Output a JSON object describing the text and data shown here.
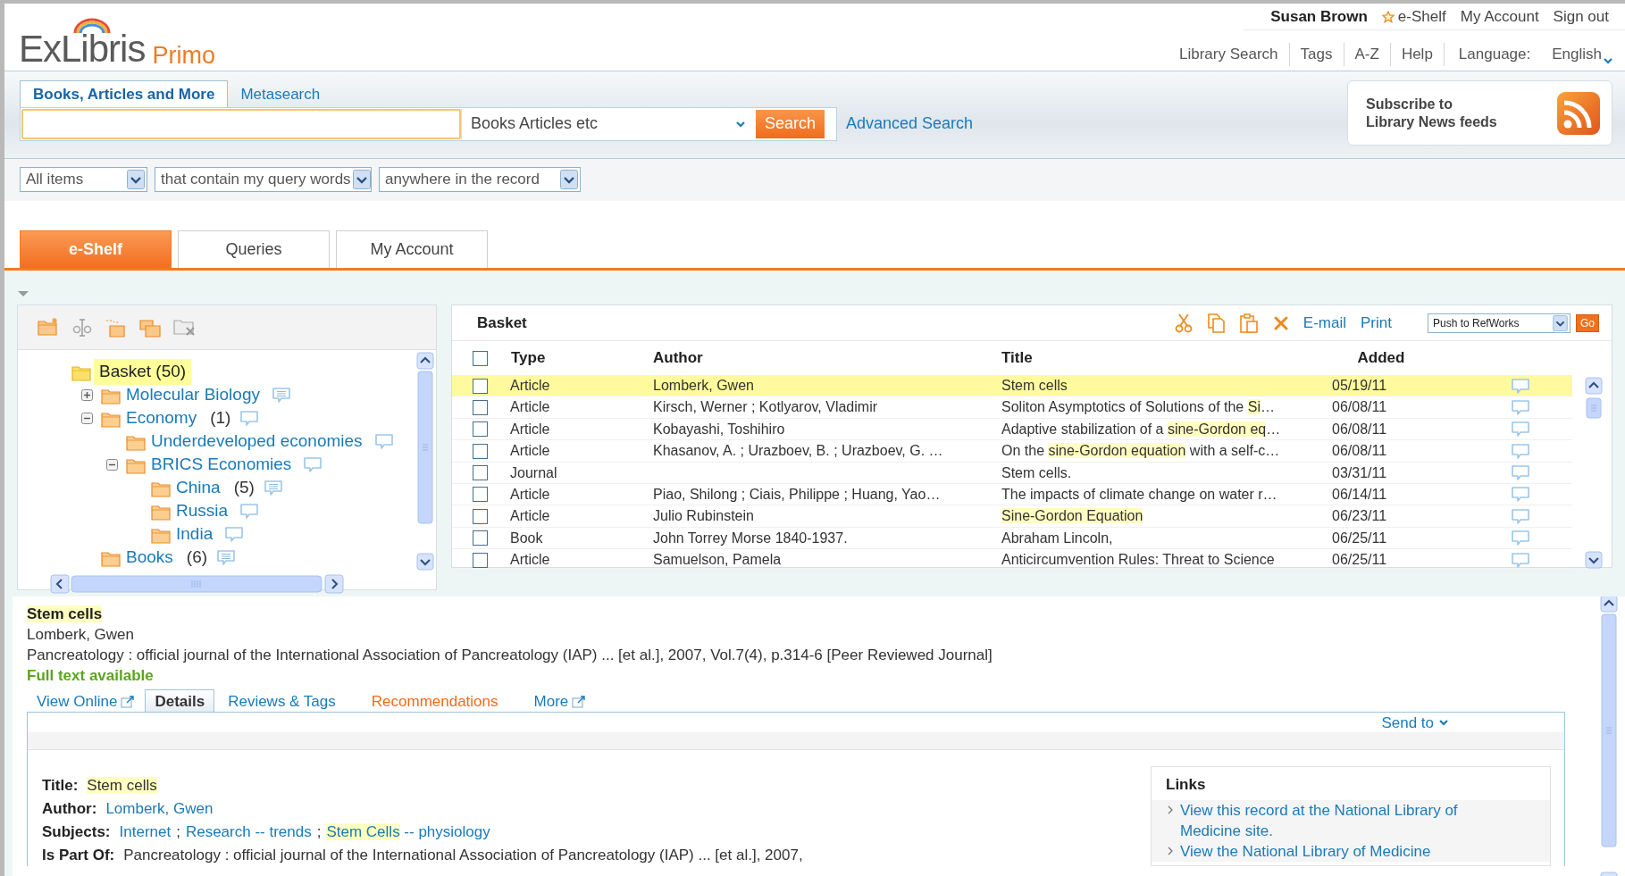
{
  "user_bar": {
    "user_name": "Susan Brown",
    "links": [
      {
        "label": "e-Shelf",
        "kind": "starred"
      },
      {
        "label": "My Account",
        "kind": "plain"
      },
      {
        "label": "Sign out",
        "kind": "plain"
      }
    ]
  },
  "logo": {
    "wordmark": "ExLibris",
    "product": "Primo"
  },
  "nav": {
    "links": [
      "Library Search",
      "Tags",
      "A-Z",
      "Help"
    ],
    "language_label": "Language:",
    "language": "English"
  },
  "search": {
    "tabs": [
      {
        "label": "Books, Articles and More",
        "selected": true
      },
      {
        "label": "Metasearch",
        "selected": false
      }
    ],
    "scope": "Books Articles etc",
    "button": "Search",
    "advanced": "Advanced Search"
  },
  "rss": {
    "text": "Subscribe to\nLibrary News feeds"
  },
  "filters": [
    "All items",
    "that contain my query words",
    "anywhere in the record"
  ],
  "main_tabs": [
    {
      "label": "e-Shelf",
      "selected": true
    },
    {
      "label": "Queries",
      "selected": false
    },
    {
      "label": "My Account",
      "selected": false
    }
  ],
  "folder_tree": [
    {
      "label": "Basket (50)",
      "selected": true,
      "children": [
        {
          "label": "Molecular Biology",
          "selected": false,
          "expanded": false,
          "has_notes": true
        },
        {
          "label": "Economy",
          "count": "(1)",
          "selected": false,
          "expanded": true,
          "has_notes": false,
          "children": [
            {
              "label": "Underdeveloped economies",
              "selected": false,
              "has_notes": false
            },
            {
              "label": "BRICS Economies",
              "selected": false,
              "expanded": true,
              "has_notes": false,
              "children": [
                {
                  "label": "China",
                  "count": "(5)",
                  "selected": false,
                  "has_notes": true
                },
                {
                  "label": "Russia",
                  "selected": false,
                  "has_notes": false
                },
                {
                  "label": "India",
                  "selected": false,
                  "has_notes": false
                }
              ]
            }
          ]
        },
        {
          "label": "Books",
          "count": "(6)",
          "selected": false,
          "has_notes": true
        }
      ]
    }
  ],
  "basket": {
    "title": "Basket",
    "actions": [
      "E-mail",
      "Print"
    ],
    "push_select": "Push to RefWorks",
    "go_button": "Go",
    "select_all_checked": false,
    "columns": [
      "Type",
      "Author",
      "Title",
      "Added"
    ],
    "rows": [
      {
        "type": "Article",
        "author": "Lomberk, Gwen",
        "title": [
          {
            "text": "Stem cells",
            "highlighted": false
          }
        ],
        "added": "05/19/11",
        "selected": true,
        "checked": false
      },
      {
        "type": "Article",
        "author": "Kirsch, Werner ; Kotlyarov, Vladimir",
        "title": [
          {
            "text": "Soliton Asymptotics of Solutions of the ",
            "highlighted": false
          },
          {
            "text": "Si",
            "highlighted": true
          },
          {
            "text": "…",
            "highlighted": false
          }
        ],
        "added": "06/08/11",
        "selected": false,
        "checked": false
      },
      {
        "type": "Article",
        "author": "Kobayashi, Toshihiro",
        "title": [
          {
            "text": "Adaptive stabilization of a ",
            "highlighted": false
          },
          {
            "text": "sine-Gordon ",
            "highlighted": true
          },
          {
            "text": "eq",
            "highlighted": true
          },
          {
            "text": "…",
            "highlighted": false
          }
        ],
        "added": "06/08/11",
        "selected": false,
        "checked": false
      },
      {
        "type": "Article",
        "author": "Khasanov, A. ; Urazboev, B. ; Urazboev, G. …",
        "title": [
          {
            "text": "On the ",
            "highlighted": false
          },
          {
            "text": "sine-Gordon equation",
            "highlighted": true
          },
          {
            "text": " with a self-c…",
            "highlighted": false
          }
        ],
        "added": "06/08/11",
        "selected": false,
        "checked": false
      },
      {
        "type": "Journal",
        "author": "",
        "title": [
          {
            "text": "Stem cells.",
            "highlighted": false
          }
        ],
        "added": "03/31/11",
        "selected": false,
        "checked": false
      },
      {
        "type": "Article",
        "author": "Piao, Shilong ; Ciais, Philippe ; Huang, Yao…",
        "title": [
          {
            "text": "The impacts of climate change on water r…",
            "highlighted": false
          }
        ],
        "added": "06/14/11",
        "selected": false,
        "checked": false
      },
      {
        "type": "Article",
        "author": "Julio Rubinstein",
        "title": [
          {
            "text": "Sine-Gordon Equation",
            "highlighted": true
          }
        ],
        "added": "06/23/11",
        "selected": false,
        "checked": false
      },
      {
        "type": "Book",
        "author": "John Torrey Morse 1840-1937.",
        "title": [
          {
            "text": "Abraham Lincoln,",
            "highlighted": false
          }
        ],
        "added": "06/25/11",
        "selected": false,
        "checked": false
      },
      {
        "type": "Article",
        "author": "Samuelson, Pamela",
        "title": [
          {
            "text": "Anticircumvention Rules: Threat to Science",
            "highlighted": false
          }
        ],
        "added": "06/25/11",
        "selected": false,
        "checked": false
      }
    ]
  },
  "record": {
    "title": [
      {
        "text": "Stem ",
        "highlighted": true
      },
      {
        "text": "cells",
        "highlighted": true
      }
    ],
    "author": "Lomberk, Gwen",
    "source": "Pancreatology : official journal of the International Association of Pancreatology (IAP) ... [et al.], 2007, Vol.7(4), p.314-6 [Peer Reviewed Journal]",
    "availability": "Full text available",
    "tabs": [
      {
        "label": "View Online",
        "kind": "external",
        "color": "#1a7ab8",
        "selected": false
      },
      {
        "label": "Details",
        "kind": "plain",
        "color": "#333333",
        "selected": true
      },
      {
        "label": "Reviews & Tags",
        "kind": "plain",
        "color": "#1a7ab8",
        "selected": false
      },
      {
        "label": "Recommendations",
        "kind": "plain",
        "color": "#f26a1b",
        "selected": false
      },
      {
        "label": "More",
        "kind": "external",
        "color": "#1a7ab8",
        "selected": false
      }
    ],
    "send_to": "Send to",
    "details": [
      {
        "label": "Title:",
        "kind": "text",
        "parts": [
          {
            "text": "Stem ",
            "highlighted": true
          },
          {
            "text": "cells",
            "highlighted": true
          }
        ]
      },
      {
        "label": "Author:",
        "kind": "links",
        "links": [
          {
            "parts": [
              {
                "text": "Lomberk, Gwen",
                "highlighted": false
              }
            ]
          }
        ]
      },
      {
        "label": "Subjects:",
        "kind": "links",
        "separator": ";",
        "links": [
          {
            "parts": [
              {
                "text": "Internet",
                "highlighted": false
              }
            ]
          },
          {
            "parts": [
              {
                "text": "Research -- trends",
                "highlighted": false
              }
            ]
          },
          {
            "parts": [
              {
                "text": "Stem ",
                "highlighted": true
              },
              {
                "text": "Cells",
                "highlighted": true
              },
              {
                "text": " -- physiology",
                "highlighted": false
              }
            ]
          }
        ]
      },
      {
        "label": "Is Part Of:",
        "kind": "text",
        "parts": [
          {
            "text": "Pancreatology : official journal of the International Association of Pancreatology (IAP) ... [et al.], 2007,",
            "highlighted": false
          }
        ]
      }
    ],
    "links_box": {
      "title": "Links",
      "items": [
        "View this record at the National Library of Medicine site.",
        "View the National Library of Medicine"
      ]
    }
  }
}
